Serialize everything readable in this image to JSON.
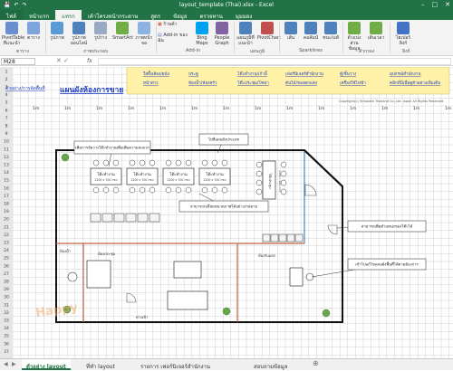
{
  "window": {
    "title": "layout_template (Thai).xlsx - Excel"
  },
  "quick_access": [
    "💾",
    "↶",
    "↷"
  ],
  "tabs": [
    "ไฟล์",
    "หน้าแรก",
    "แทรก",
    "เค้าโครงหน้ากระดาษ",
    "สูตร",
    "ข้อมูล",
    "ตรวจทาน",
    "มุมมอง"
  ],
  "ribbon": {
    "buttons": [
      "PivotTable ที่แนะนำ",
      "ตาราง",
      "รูปภาพ",
      "รูปภาพออนไลน์",
      "รูปร่าง",
      "SmartArt",
      "ภาพหน้าจอ",
      "ร้านค้า",
      "Add-in ของฉัน",
      "Bing Maps",
      "People Graph",
      "แผนภูมิที่แนะนำ",
      "PivotChart",
      "เส้น",
      "คอลัมน์",
      "ชนะ/แพ้",
      "ตัวแบ่งส่วนข้อมูล",
      "เส้นเวลา",
      "ไฮเปอร์ลิงก์"
    ],
    "groups": [
      "ตาราง",
      "ภาพประกอบ",
      "Add-in",
      "แผนภูมิ",
      "Sparklines",
      "ตัวกรอง",
      "ลิงก์"
    ]
  },
  "formula_bar": {
    "name_box": "M28",
    "fx": "fx",
    "value": ""
  },
  "sheet": {
    "nav_link": "ตัวอย่าง/การจัดพื้นที่",
    "title": "แผนผังห้องการขาย",
    "top_links": [
      "ใส่พื้นห้อง/ผนัง",
      "ประตู",
      "โต๊ะทำงาน/เก้าอี้",
      "เฟอร์นิเจอร์สำนักงาน",
      "ตู้/ชั้นวาง",
      "อุปกรณ์สำนักงาน",
      "หน้าต่าง",
      "ห้องน้ำ/ห้องครัว",
      "โต๊ะประชุม/โซฟา",
      "ต้นไม้/ของตกแต่ง",
      "เครื่องใช้ไฟฟ้า",
      "คลิกที่นี่เพื่อดูตัวอย่างเพิ่มเติม"
    ],
    "copyright": "Copyright(c) Template Thailand Co.,Ltd. Japan All Rights Reserved",
    "row_numbers": [
      "1",
      "2",
      "3",
      "4",
      "5",
      "6",
      "7",
      "8",
      "9",
      "10",
      "11",
      "12",
      "13",
      "14",
      "15",
      "16",
      "17",
      "18",
      "19",
      "20",
      "21",
      "22",
      "23",
      "24",
      "25",
      "26",
      "27",
      "28",
      "29",
      "30",
      "31",
      "32",
      "33",
      "34",
      "35",
      "36",
      "37"
    ],
    "scale_label": "1m",
    "callouts": [
      "เพิ่มการจัดวางโต๊ะทำงานเพื่อเพิ่มความสะดวก",
      "ไปที่แผนผังประเภท",
      "สามารถเปลี่ยนขนาดภาพได้อย่างง่ายดาย",
      "สามารถเพิ่มตำแหน่งของโต๊ะได้",
      "เข้าไปแก้ไขแผนผังพื้นที่ได้ตามต้องการ"
    ],
    "desk_labels": [
      "โต๊ะทำงาน",
      "โต๊ะทำงาน",
      "โต๊ะทำงาน",
      "โต๊ะทำงาน",
      "โต๊ะประชุม"
    ],
    "desk_sizes": [
      "1200 x 700 mm",
      "1200 x 700 mm",
      "1200 x 700 mm",
      "1200 x 700 mm",
      "2400 x 900 mm"
    ],
    "room_labels": [
      "ห้องประชุม",
      "ห้องน้ำ",
      "ทางเข้า",
      "ห้องรับแขก"
    ],
    "watermark": "Happy"
  },
  "sheet_tabs": [
    "ตัวอย่าง layout",
    "ที่ทำ layout",
    "รายการ เฟอร์นิเจอร์สำนักงาน",
    "สอบถามข้อมูล"
  ],
  "colors": {
    "excel_green": "#217346",
    "link_blue": "#1f3fbf",
    "link_cell_bg": "#fff2a8",
    "header_bg": "#e6e6e6",
    "callout_bg": "#ffffff"
  }
}
